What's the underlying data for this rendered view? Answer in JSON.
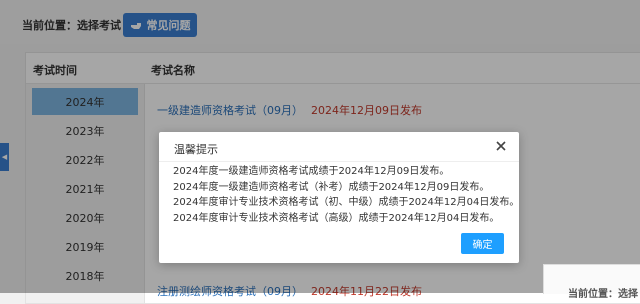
{
  "header": {
    "location": "当前位置：选择考试",
    "faq_label": "常见问题"
  },
  "table": {
    "col_time": "考试时间",
    "col_name": "考试名称"
  },
  "years": [
    "2024年",
    "2023年",
    "2022年",
    "2021年",
    "2020年",
    "2019年",
    "2018年"
  ],
  "active_year": "2024年",
  "exams": [
    {
      "name": "一级建造师资格考试（09月）",
      "date": "2024年12月09日发布"
    },
    {
      "name": "注册测绘师资格考试（09月）",
      "date": "2024年11月22日发布"
    }
  ],
  "corner": {
    "text": "当前位置：选择"
  },
  "modal": {
    "title": "温馨提示",
    "lines": [
      "2024年度一级建造师资格考试成绩于2024年12月09日发布。",
      "2024年度一级建造师资格考试（补考）成绩于2024年12月09日发布。",
      "2024年度审计专业技术资格考试（初、中级）成绩于2024年12月04日发布。",
      "2024年度审计专业技术资格考试（高级）成绩于2024年12月04日发布。"
    ],
    "ok_label": "确定"
  },
  "colors": {
    "accent": "#3b7fd2",
    "active_year_bg": "#7fb5e0",
    "link": "#2a6fb9",
    "date_red": "#c0392b",
    "ok_button": "#1e9fff"
  }
}
